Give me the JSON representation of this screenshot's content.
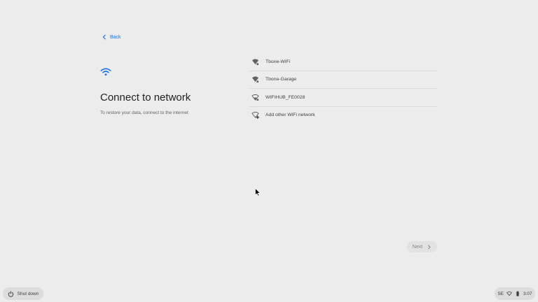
{
  "header": {
    "back_label": "Back"
  },
  "main": {
    "title": "Connect to network",
    "subtitle": "To restore your data, connect to the internet"
  },
  "networks": [
    {
      "name": "Tbone-WiFi",
      "icon": "wifi-secured-icon"
    },
    {
      "name": "Tbone-Garage",
      "icon": "wifi-secured-icon"
    },
    {
      "name": "WIFIHUB_FE0028",
      "icon": "wifi-weak-secured-icon"
    },
    {
      "name": "Add other WiFi network",
      "icon": "wifi-add-icon"
    }
  ],
  "footer": {
    "next_label": "Next",
    "shutdown_label": "Shut down"
  },
  "tray": {
    "locale": "SE",
    "time": "3:07"
  },
  "colors": {
    "accent": "#1a73e8",
    "background": "#ececec",
    "text_primary": "#202124",
    "text_secondary": "#5f6368"
  }
}
